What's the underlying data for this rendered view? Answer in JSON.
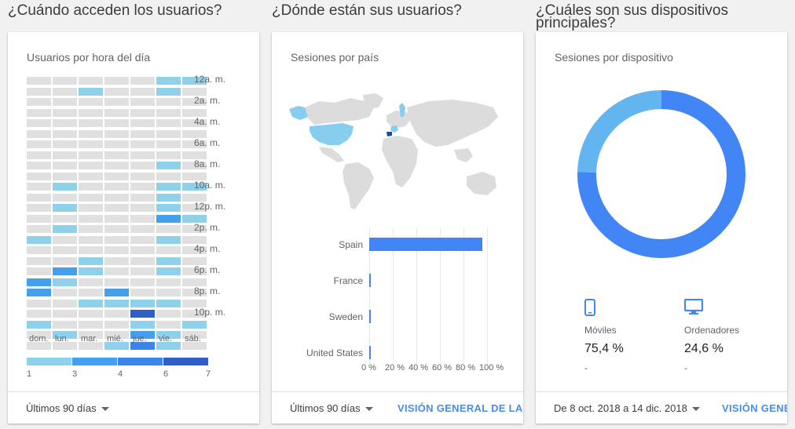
{
  "sections": {
    "when": "¿Cuándo acceden los usuarios?",
    "where": "¿Dónde están sus usuarios?",
    "devices_line1": "¿Cuáles son sus dispositivos",
    "devices_line2": "principales?"
  },
  "card_hours": {
    "title": "Usuarios por hora del día",
    "hour_labels": [
      "12a. m.",
      "2a. m.",
      "4a. m.",
      "6a. m.",
      "8a. m.",
      "10a. m.",
      "12p. m.",
      "2p. m.",
      "4p. m.",
      "6p. m.",
      "8p. m.",
      "10p. m."
    ],
    "day_labels": [
      "dom.",
      "lun.",
      "mar.",
      "mié.",
      "jue.",
      "vie.",
      "sáb."
    ],
    "legend_values": [
      "1",
      "3",
      "4",
      "6",
      "7"
    ],
    "legend_colors": [
      "#8fd1ea",
      "#42a0ef",
      "#3c84ea",
      "#2f5fc4"
    ],
    "empty_color": "#e0e0e0",
    "footer_range": "Últimos 90 días"
  },
  "chart_data": [
    {
      "type": "heatmap",
      "title": "Usuarios por hora del día",
      "x": [
        "dom.",
        "lun.",
        "mar.",
        "mié.",
        "jue.",
        "vie.",
        "sáb."
      ],
      "y_hours": [
        0,
        1,
        2,
        3,
        4,
        5,
        6,
        7,
        8,
        9,
        10,
        11,
        12,
        13,
        14,
        15,
        16,
        17,
        18,
        19,
        20,
        21,
        22,
        23
      ],
      "values": [
        [
          0,
          0,
          0,
          0,
          0,
          1,
          1
        ],
        [
          0,
          0,
          1,
          0,
          0,
          1,
          0
        ],
        [
          0,
          0,
          0,
          0,
          0,
          0,
          0
        ],
        [
          0,
          0,
          0,
          0,
          0,
          0,
          0
        ],
        [
          0,
          0,
          0,
          0,
          0,
          0,
          0
        ],
        [
          0,
          0,
          0,
          0,
          0,
          0,
          0
        ],
        [
          0,
          0,
          0,
          0,
          0,
          0,
          0
        ],
        [
          0,
          0,
          0,
          0,
          0,
          0,
          0
        ],
        [
          0,
          0,
          0,
          0,
          0,
          1,
          0
        ],
        [
          0,
          0,
          0,
          0,
          0,
          0,
          0
        ],
        [
          0,
          1,
          0,
          0,
          0,
          1,
          1
        ],
        [
          0,
          0,
          0,
          0,
          0,
          1,
          0
        ],
        [
          0,
          1,
          0,
          0,
          0,
          1,
          0
        ],
        [
          0,
          0,
          0,
          0,
          0,
          3,
          1
        ],
        [
          0,
          1,
          0,
          0,
          0,
          0,
          0
        ],
        [
          1,
          0,
          0,
          0,
          0,
          1,
          0
        ],
        [
          0,
          0,
          0,
          0,
          0,
          0,
          0
        ],
        [
          0,
          0,
          1,
          0,
          0,
          1,
          0
        ],
        [
          0,
          3,
          1,
          0,
          0,
          1,
          0
        ],
        [
          3,
          1,
          0,
          0,
          0,
          0,
          0
        ],
        [
          3,
          0,
          0,
          3,
          0,
          0,
          0
        ],
        [
          0,
          0,
          1,
          1,
          1,
          1,
          0
        ],
        [
          0,
          0,
          0,
          0,
          6,
          0,
          0
        ],
        [
          1,
          0,
          0,
          0,
          1,
          0,
          1
        ],
        [
          0,
          1,
          0,
          0,
          3,
          1,
          0
        ],
        [
          0,
          0,
          0,
          1,
          4,
          1,
          0
        ]
      ]
    },
    {
      "type": "bar",
      "title": "Sesiones por país",
      "categories": [
        "Spain",
        "France",
        "Sweden",
        "United States"
      ],
      "values": [
        96,
        1,
        1,
        1
      ],
      "xticks": [
        "0 %",
        "20 %",
        "40 %",
        "60 %",
        "80 %",
        "100 %"
      ],
      "xlim": [
        0,
        100
      ]
    },
    {
      "type": "pie",
      "title": "Sesiones por dispositivo",
      "categories": [
        "Móviles",
        "Ordenadores"
      ],
      "values": [
        75.4,
        24.6
      ],
      "colors": [
        "#4285f4",
        "#63b5ef"
      ]
    }
  ],
  "card_country": {
    "title": "Sesiones por país",
    "categories": [
      "Spain",
      "France",
      "Sweden",
      "United States"
    ],
    "xticks": [
      "0 %",
      "20 %",
      "40 %",
      "60 %",
      "80 %",
      "100 %"
    ],
    "footer_range": "Últimos 90 días",
    "footer_link": "VISIÓN GENERAL DE LAS UBICACIONES",
    "map_colors": {
      "land": "#dcdcdc",
      "highlight": "#86cdf0",
      "spain": "#1a4c9c"
    }
  },
  "card_devices": {
    "title": "Sesiones por dispositivo",
    "mobile_label": "Móviles",
    "mobile_value": "75,4 %",
    "mobile_change": "-",
    "desktop_label": "Ordenadores",
    "desktop_value": "24,6 %",
    "desktop_change": "-",
    "footer_range": "De 8 oct. 2018 a 14 dic. 2018",
    "footer_link": "VISIÓN GENERAL DE LA TECNOLOGÍA",
    "icon_color": "#4285f4"
  }
}
